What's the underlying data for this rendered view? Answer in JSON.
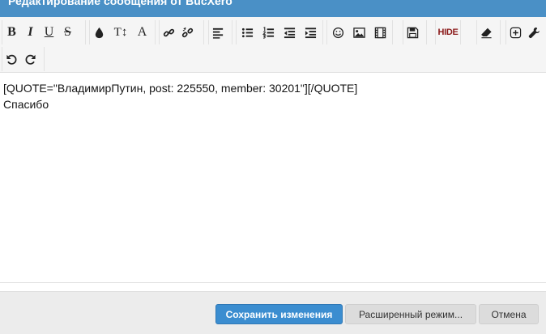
{
  "dialog": {
    "title": "Редактирование сообщения от BucXero"
  },
  "toolbar": {
    "rows": [
      [
        "bold-icon",
        "italic-icon",
        "underline-icon",
        "strikethrough-icon",
        "text-color-icon",
        "font-size-icon",
        "font-family-icon",
        "link-icon",
        "unlink-icon",
        "align-left-icon",
        "bullet-list-icon",
        "numbered-list-icon",
        "outdent-icon",
        "indent-icon",
        "smilie-icon",
        "image-icon",
        "media-icon",
        "save-draft-icon",
        "hide-icon",
        "remove-format-icon",
        "insert-icon",
        "tools-icon"
      ],
      [
        "undo-icon",
        "redo-icon"
      ]
    ],
    "glyphs": {
      "bold": "B",
      "italic": "I",
      "underline": "U",
      "strike": "S",
      "font_size": "T↕",
      "font_family": "A",
      "hide": "HIDE"
    }
  },
  "editor": {
    "line1": "[QUOTE=\"ВладимирПутин, post: 225550, member: 30201\"][/QUOTE]",
    "line2": "Спасибо"
  },
  "footer": {
    "save_label": "Сохранить изменения",
    "advanced_label": "Расширенный режим...",
    "cancel_label": "Отмена"
  },
  "colors": {
    "titlebar": "#4a90c6",
    "primary_button": "#3b8dd0",
    "hide_text": "#8b1a1a"
  }
}
